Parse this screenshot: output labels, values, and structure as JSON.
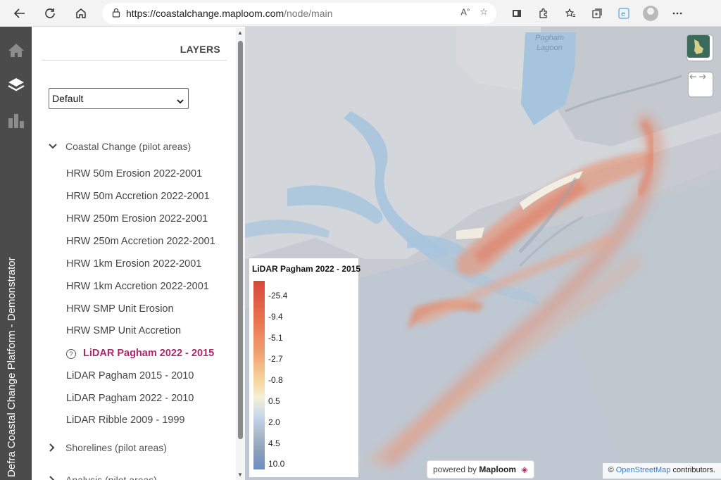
{
  "browser": {
    "url_host": "https://coastalchange.maploom.com",
    "url_path": "/node/main"
  },
  "app": {
    "title": "Defra Coastal Change Platform - Demonstrator",
    "rail_icons": [
      "home-icon",
      "layers-icon",
      "chart-icon"
    ]
  },
  "layers_panel": {
    "title": "LAYERS",
    "preset": "Default",
    "groups": [
      {
        "label": "Coastal Change (pilot areas)",
        "expanded": true
      },
      {
        "label": "Shorelines (pilot areas)",
        "expanded": false
      },
      {
        "label": "Analysis (pilot areas)",
        "expanded": false
      }
    ],
    "layers": [
      "HRW 50m Erosion 2022-2001",
      "HRW 50m Accretion 2022-2001",
      "HRW 250m Erosion 2022-2001",
      "HRW 250m Accretion 2022-2001",
      "HRW 1km Erosion 2022-2001",
      "HRW 1km Accretion 2022-2001",
      "HRW SMP Unit Erosion",
      "HRW SMP Unit Accretion",
      "LiDAR Pagham 2022 - 2015",
      "LiDAR Pagham 2015 - 2010",
      "LiDAR Pagham 2022 - 2010",
      "LiDAR Ribble 2009 - 1999"
    ],
    "active_layer_index": 8,
    "active_color": "#b0256e"
  },
  "map": {
    "place_label_1": "Pagham",
    "place_label_2": "Lagoon",
    "legend": {
      "title": "LiDAR Pagham 2022 - 2015",
      "labels": [
        "-25.4",
        "-9.4",
        "-5.1",
        "-2.7",
        "-0.8",
        "0.5",
        "2.0",
        "4.5",
        "10.0"
      ]
    },
    "powered_prefix": "powered by",
    "powered_brand": "Maploom",
    "attribution_symbol": "©",
    "attribution_link": "OpenStreetMap",
    "attribution_suffix": "contributors."
  }
}
